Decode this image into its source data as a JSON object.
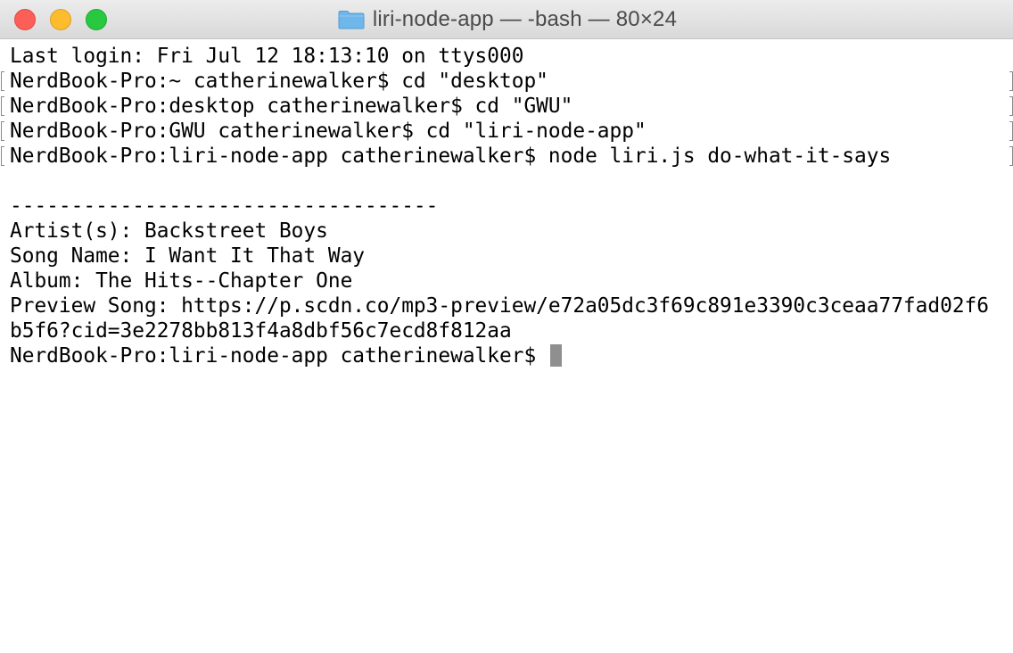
{
  "window": {
    "title": "liri-node-app — -bash — 80×24",
    "folder_icon": "folder-icon",
    "traffic_lights": {
      "close": "#fc5f57",
      "minimize": "#fdbc2e",
      "zoom": "#28c840"
    }
  },
  "terminal": {
    "lines": [
      "Last login: Fri Jul 12 18:13:10 on ttys000",
      "NerdBook-Pro:~ catherinewalker$ cd \"desktop\"",
      "NerdBook-Pro:desktop catherinewalker$ cd \"GWU\"",
      "NerdBook-Pro:GWU catherinewalker$ cd \"liri-node-app\"",
      "NerdBook-Pro:liri-node-app catherinewalker$ node liri.js do-what-it-says",
      "",
      "-----------------------------------",
      "Artist(s): Backstreet Boys",
      "Song Name: I Want It That Way",
      "Album: The Hits--Chapter One",
      "Preview Song: https://p.scdn.co/mp3-preview/e72a05dc3f69c891e3390c3ceaa77fad02f6",
      "b5f6?cid=3e2278bb813f4a8dbf56c7ecd8f812aa",
      "NerdBook-Pro:liri-node-app catherinewalker$ "
    ]
  }
}
